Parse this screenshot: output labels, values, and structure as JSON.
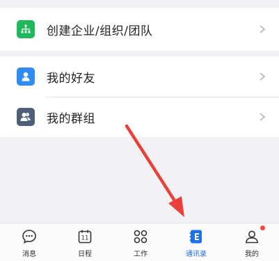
{
  "menu": {
    "create_org": {
      "label": "创建企业/组织/团队",
      "icon": "org-tree-icon",
      "icon_color": "#1fb85b"
    },
    "friends": {
      "label": "我的好友",
      "icon": "person-icon",
      "icon_color": "#2f8cf2"
    },
    "groups": {
      "label": "我的群组",
      "icon": "group-icon",
      "icon_color": "#4f5f78"
    }
  },
  "tabs": [
    {
      "label": "消息",
      "icon": "chat-bubble-icon"
    },
    {
      "label": "日程",
      "icon": "calendar-icon",
      "icon_text": "11"
    },
    {
      "label": "工作",
      "icon": "grid-apps-icon"
    },
    {
      "label": "通讯录",
      "icon": "contacts-book-icon",
      "active": true
    },
    {
      "label": "我的",
      "icon": "profile-icon",
      "badge": true
    }
  ],
  "colors": {
    "accent": "#1e6ff2",
    "annotation_arrow": "#e8403a"
  }
}
